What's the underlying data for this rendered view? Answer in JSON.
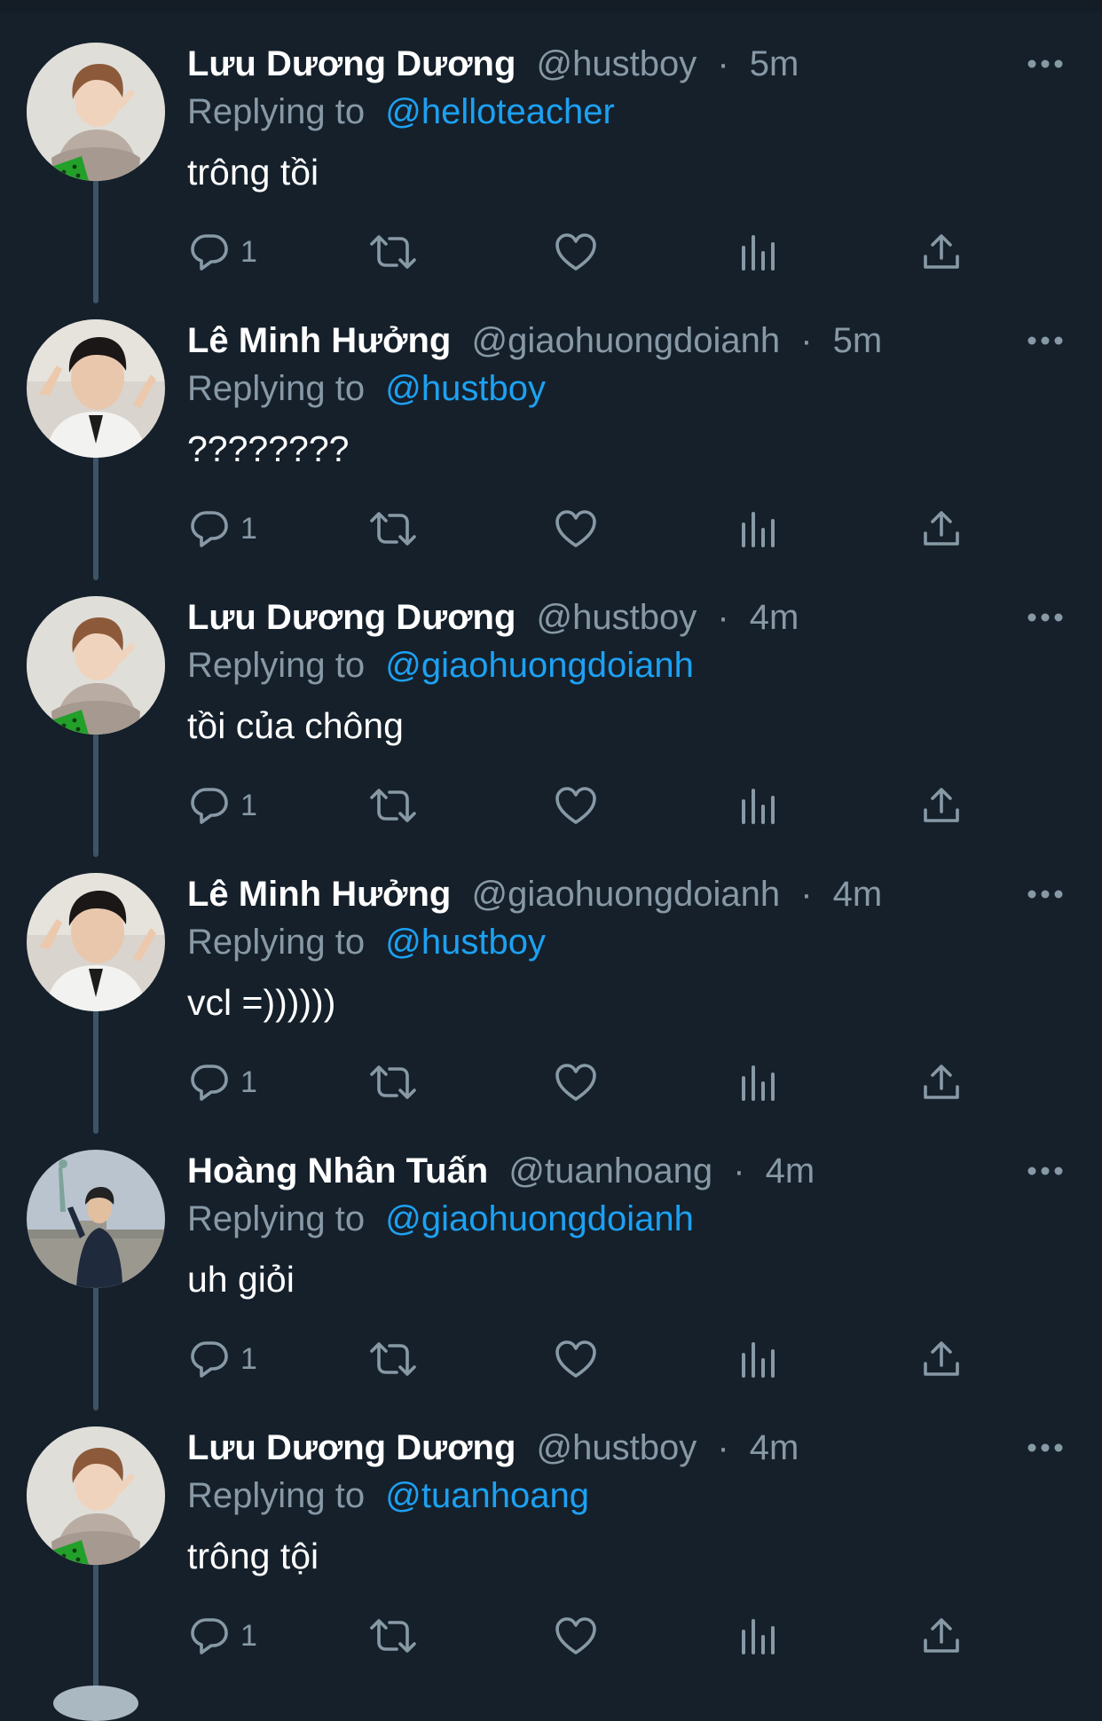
{
  "theme": {
    "background": "#15202b",
    "text_primary": "#ffffff",
    "text_secondary": "#8899a6",
    "accent": "#1da1f2",
    "thread_line": "#3d5466"
  },
  "labels": {
    "replying_to": "Replying to",
    "separator": "·"
  },
  "tweets": [
    {
      "name": "Lưu Dương Dương",
      "handle": "@hustboy",
      "time": "5m",
      "replying_to": "@helloteacher",
      "text": "trông tồi",
      "reply_count": "1",
      "avatar": "avatar-hustboy"
    },
    {
      "name": "Lê Minh Hưởng",
      "handle": "@giaohuongdoianh",
      "time": "5m",
      "replying_to": "@hustboy",
      "text": "????????",
      "reply_count": "1",
      "avatar": "avatar-giaohuongdoianh"
    },
    {
      "name": "Lưu Dương Dương",
      "handle": "@hustboy",
      "time": "4m",
      "replying_to": "@giaohuongdoianh",
      "text": "tồi của chông",
      "reply_count": "1",
      "avatar": "avatar-hustboy"
    },
    {
      "name": "Lê Minh Hưởng",
      "handle": "@giaohuongdoianh",
      "time": "4m",
      "replying_to": "@hustboy",
      "text": "vcl =))))))",
      "reply_count": "1",
      "avatar": "avatar-giaohuongdoianh"
    },
    {
      "name": "Hoàng Nhân Tuấn",
      "handle": "@tuanhoang",
      "time": "4m",
      "replying_to": "@giaohuongdoianh",
      "text": "uh giỏi",
      "reply_count": "1",
      "avatar": "avatar-tuanhoang"
    },
    {
      "name": "Lưu Dương Dương",
      "handle": "@hustboy",
      "time": "4m",
      "replying_to": "@tuanhoang",
      "text": "trông tội",
      "reply_count": "1",
      "avatar": "avatar-hustboy"
    }
  ],
  "icons": {
    "reply": "reply-icon",
    "retweet": "retweet-icon",
    "like": "heart-icon",
    "analytics": "analytics-icon",
    "share": "share-icon",
    "more": "more-options-icon"
  }
}
